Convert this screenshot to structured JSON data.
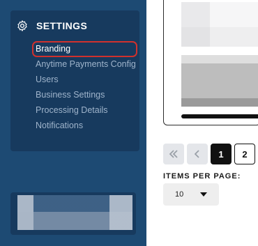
{
  "sidebar": {
    "section_title": "SETTINGS",
    "section_icon": "gear-icon",
    "items": [
      {
        "label": "Branding",
        "active": true
      },
      {
        "label": "Anytime Payments Config",
        "active": false
      },
      {
        "label": "Users",
        "active": false
      },
      {
        "label": "Business Settings",
        "active": false
      },
      {
        "label": "Processing Details",
        "active": false
      },
      {
        "label": "Notifications",
        "active": false
      }
    ]
  },
  "pagination": {
    "first_icon": "double-chevron-left-icon",
    "prev_icon": "chevron-left-icon",
    "pages": [
      "1",
      "2"
    ],
    "current_page": "1"
  },
  "items_per_page": {
    "label": "ITEMS PER PAGE:",
    "value": "10"
  },
  "colors": {
    "sidebar_bg": "#1d4a73",
    "panel_bg": "#173a5e",
    "active_outline": "#d0312d",
    "menu_text": "#9fb4cb"
  }
}
